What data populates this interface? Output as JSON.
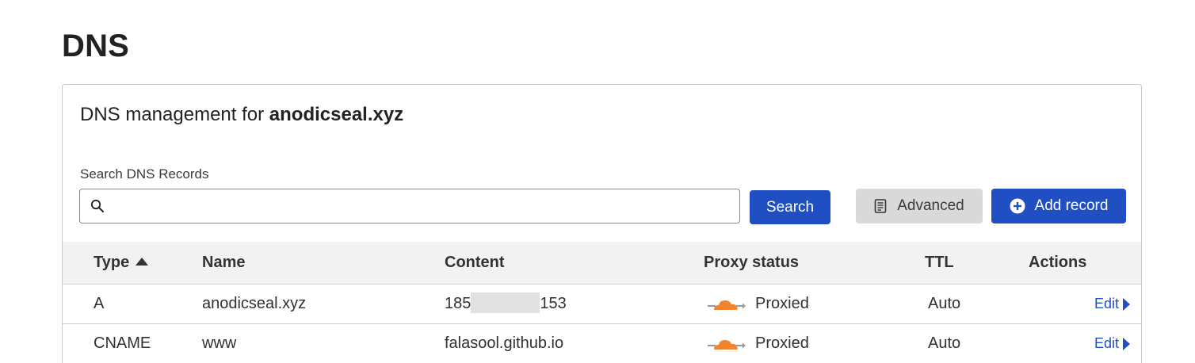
{
  "page": {
    "title": "DNS"
  },
  "card": {
    "heading_prefix": "DNS management for",
    "domain": "anodicseal.xyz"
  },
  "search": {
    "label": "Search DNS Records",
    "value": "",
    "placeholder": "",
    "button_label": "Search",
    "icon": "search-icon"
  },
  "toolbar": {
    "advanced_label": "Advanced",
    "advanced_icon": "document-icon",
    "add_record_label": "Add record",
    "add_record_icon": "plus-circle-icon"
  },
  "table": {
    "columns": {
      "type": "Type",
      "name": "Name",
      "content": "Content",
      "proxy_status": "Proxy status",
      "ttl": "TTL",
      "actions": "Actions"
    },
    "sort": {
      "column": "type",
      "direction": "ascending"
    },
    "rows": [
      {
        "type": "A",
        "name": "anodicseal.xyz",
        "content_start": "185",
        "content_end": "153",
        "content_redacted": true,
        "proxy_status": "Proxied",
        "ttl": "Auto",
        "action": "Edit"
      },
      {
        "type": "CNAME",
        "name": "www",
        "content": "falasool.github.io",
        "proxy_status": "Proxied",
        "ttl": "Auto",
        "action": "Edit"
      }
    ]
  },
  "colors": {
    "primary_blue": "#1f4fc2",
    "cloud_orange": "#f0852d",
    "header_bg": "#f2f2f2",
    "advanced_bg": "#d9d9d9"
  }
}
